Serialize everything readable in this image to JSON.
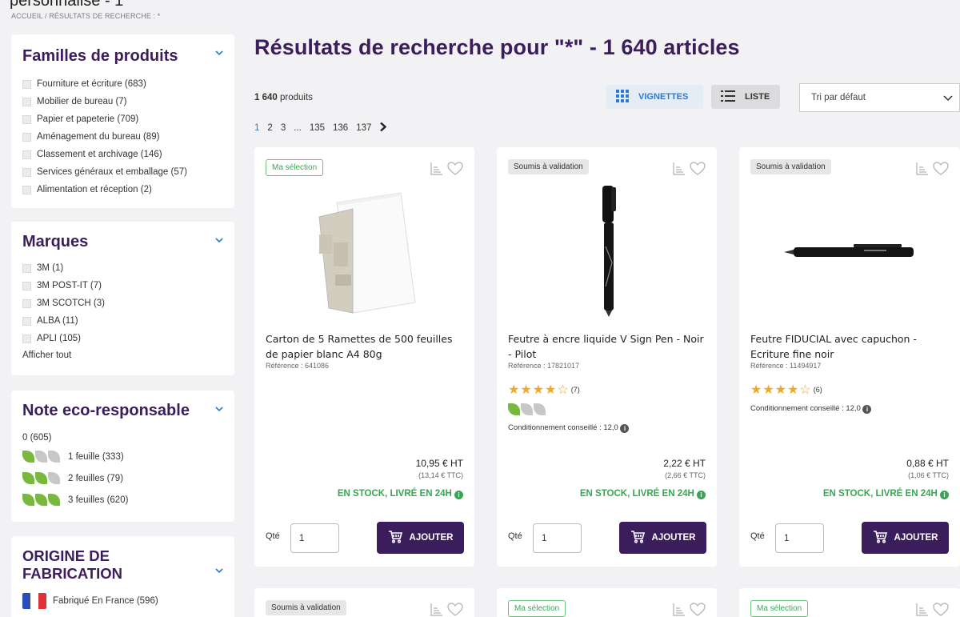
{
  "top_cut_text": "personnalisé - 1",
  "breadcrumb": {
    "home": "ACCUEIL",
    "sep": "/",
    "current": "RÉSULTATS DE RECHERCHE : *"
  },
  "families": {
    "title": "Familles de produits",
    "items": [
      {
        "label": "Fourniture et écriture (683)"
      },
      {
        "label": "Mobilier de bureau (7)"
      },
      {
        "label": "Papier et papeterie (709)"
      },
      {
        "label": "Aménagement du bureau (89)"
      },
      {
        "label": "Classement et archivage (146)"
      },
      {
        "label": "Services généraux et emballage (57)"
      },
      {
        "label": "Alimentation et réception (2)"
      }
    ]
  },
  "brands": {
    "title": "Marques",
    "items": [
      {
        "label": "3M (1)"
      },
      {
        "label": "3M POST-IT (7)"
      },
      {
        "label": "3M SCOTCH (3)"
      },
      {
        "label": "ALBA (11)"
      },
      {
        "label": "APLI (105)"
      }
    ],
    "show_all": "Afficher tout"
  },
  "eco": {
    "title": "Note eco-responsable",
    "zero": "0 (605)",
    "levels": [
      {
        "label": "1 feuille (333)",
        "leaves": 1
      },
      {
        "label": "2 feuilles (79)",
        "leaves": 2
      },
      {
        "label": "3 feuilles (620)",
        "leaves": 3
      }
    ]
  },
  "origin": {
    "title": "ORIGINE DE FABRICATION",
    "item": "Fabriqué En France (596)"
  },
  "results": {
    "title": "Résultats de recherche pour \"*\" - 1 640 articles",
    "count_num": "1 640",
    "count_label": "produits",
    "view_grid": "VIGNETTES",
    "view_list": "LISTE",
    "sort": "Tri par défaut",
    "pages": [
      "1",
      "2",
      "3",
      "...",
      "135",
      "136",
      "137"
    ]
  },
  "products": [
    {
      "badge": "Ma sélection",
      "name": "Carton de 5 Ramettes de 500 feuilles de papier blanc A4 80g",
      "ref": "Référence : 641086",
      "ht": "10,95 € HT",
      "ttc": "(13,14 € TTC)",
      "stock": "EN STOCK, LIVRÉ EN 24H",
      "qty_label": "Qté",
      "qty": "1",
      "add": "AJOUTER"
    },
    {
      "badge": "Soumis à validation",
      "name": "Feutre à encre liquide V Sign Pen - Noir - Pilot",
      "ref": "Référence : 17821017",
      "stars": "★★★★☆",
      "rating_count": "(7)",
      "eco_leaves": 1,
      "cond": "Conditionnement conseillé : 12,0",
      "ht": "2,22 € HT",
      "ttc": "(2,66 € TTC)",
      "stock": "EN STOCK, LIVRÉ EN 24H",
      "qty_label": "Qté",
      "qty": "1",
      "add": "AJOUTER"
    },
    {
      "badge": "Soumis à validation",
      "name": "Feutre FIDUCIAL avec capuchon - Ecriture fine noir",
      "ref": "Référence : 11494917",
      "stars": "★★★★☆",
      "rating_count": "(6)",
      "cond": "Conditionnement conseillé : 12,0",
      "ht": "0,88 € HT",
      "ttc": "(1,06 € TTC)",
      "stock": "EN STOCK, LIVRÉ EN 24H",
      "qty_label": "Qté",
      "qty": "1",
      "add": "AJOUTER"
    }
  ],
  "products_row2": [
    {
      "badge": "Soumis à validation"
    },
    {
      "badge": "Ma sélection"
    },
    {
      "badge": "Ma sélection"
    }
  ],
  "info_glyph": "i",
  "colors": {
    "brand": "#3b1d5c",
    "accent": "#2c7bd1",
    "stock": "#3aa556",
    "leaf_on": "#78b83c",
    "leaf_off": "#c6c8c6",
    "star": "#f0a826"
  }
}
